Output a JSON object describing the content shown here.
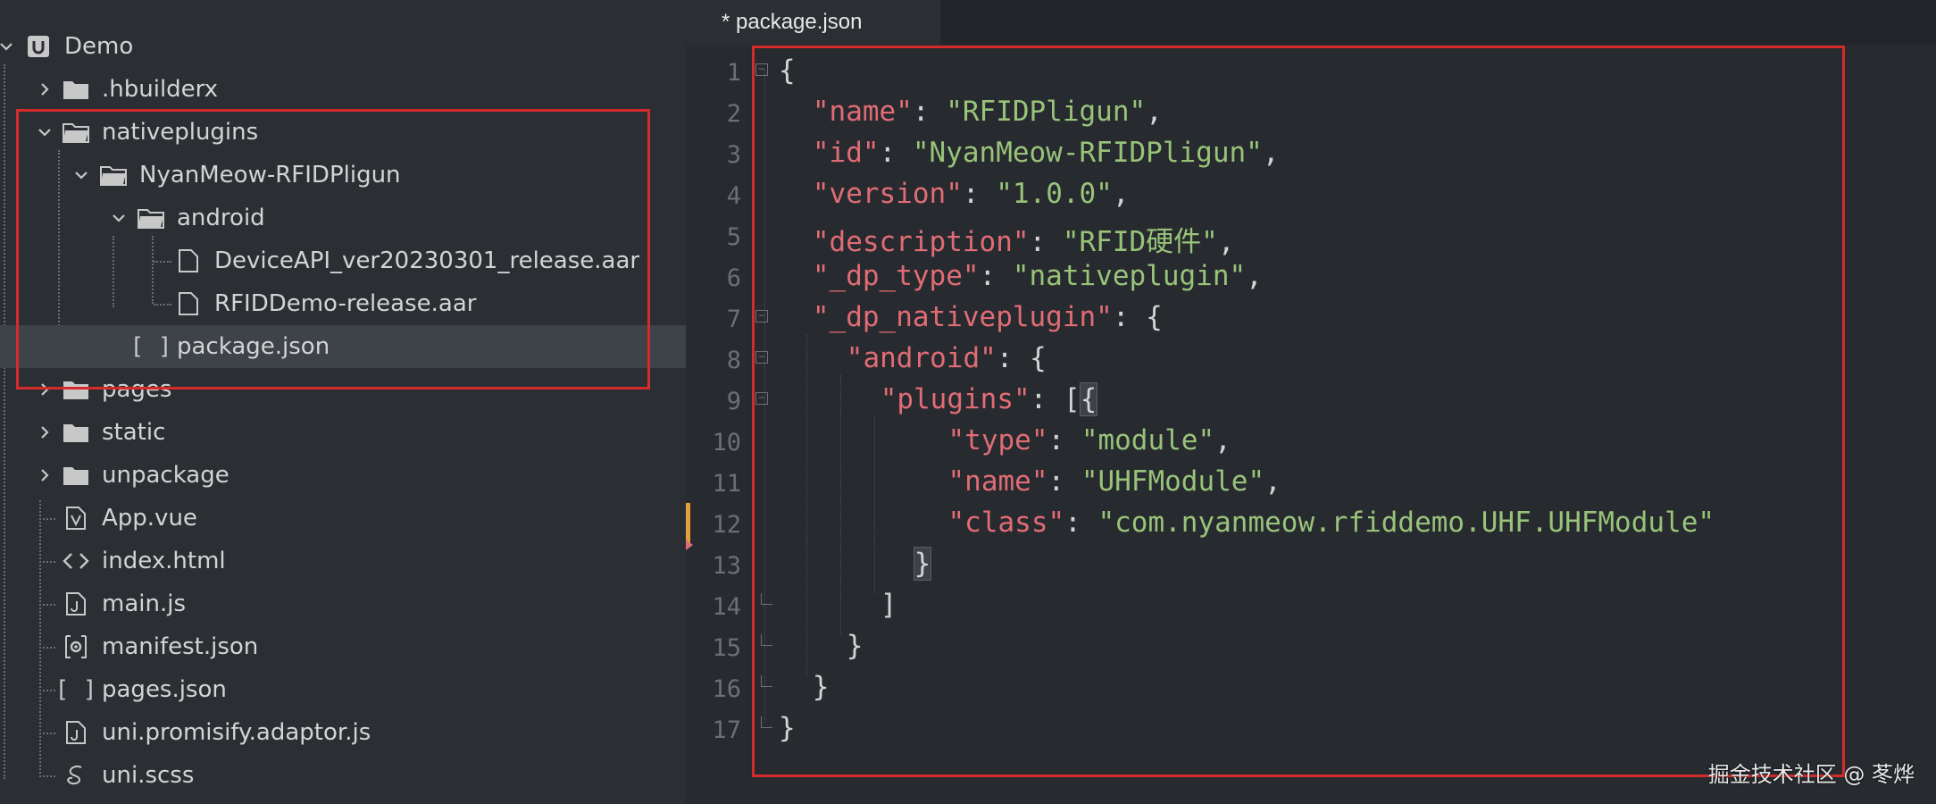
{
  "sidebar": {
    "root": {
      "label": "Demo",
      "icon": "project-icon"
    },
    "items": [
      {
        "label": ".hbuilderx",
        "type": "folder",
        "state": "collapsed"
      },
      {
        "label": "nativeplugins",
        "type": "folder",
        "state": "expanded"
      },
      {
        "label": "NyanMeow-RFIDPligun",
        "type": "folder",
        "state": "expanded"
      },
      {
        "label": "android",
        "type": "folder",
        "state": "expanded"
      },
      {
        "label": "DeviceAPI_ver20230301_release.aar",
        "type": "file"
      },
      {
        "label": "RFIDDemo-release.aar",
        "type": "file"
      },
      {
        "label": "package.json",
        "type": "json",
        "selected": true
      },
      {
        "label": "pages",
        "type": "folder",
        "state": "collapsed"
      },
      {
        "label": "static",
        "type": "folder",
        "state": "collapsed"
      },
      {
        "label": "unpackage",
        "type": "folder",
        "state": "collapsed"
      },
      {
        "label": "App.vue",
        "type": "vue"
      },
      {
        "label": "index.html",
        "type": "html"
      },
      {
        "label": "main.js",
        "type": "js"
      },
      {
        "label": "manifest.json",
        "type": "manifest"
      },
      {
        "label": "pages.json",
        "type": "json"
      },
      {
        "label": "uni.promisify.adaptor.js",
        "type": "js"
      },
      {
        "label": "uni.scss",
        "type": "scss"
      }
    ]
  },
  "editor": {
    "tab_label": "* package.json",
    "line_numbers": [
      "1",
      "2",
      "3",
      "4",
      "5",
      "6",
      "7",
      "8",
      "9",
      "10",
      "11",
      "12",
      "13",
      "14",
      "15",
      "16",
      "17"
    ],
    "lines": [
      {
        "open": "{"
      },
      {
        "key": "\"name\"",
        "colon": ": ",
        "value": "\"RFIDPligun\"",
        "tail": ","
      },
      {
        "key": "\"id\"",
        "colon": ": ",
        "value": "\"NyanMeow-RFIDPligun\"",
        "tail": ","
      },
      {
        "key": "\"version\"",
        "colon": ": ",
        "value": "\"1.0.0\"",
        "tail": ","
      },
      {
        "key": "\"description\"",
        "colon": ": ",
        "value": "\"RFID硬件\"",
        "tail": ","
      },
      {
        "key": "\"_dp_type\"",
        "colon": ": ",
        "value": "\"nativeplugin\"",
        "tail": ","
      },
      {
        "key": "\"_dp_nativeplugin\"",
        "colon": ": ",
        "tail": "{"
      },
      {
        "key": "\"android\"",
        "colon": ": ",
        "tail": "{"
      },
      {
        "key": "\"plugins\"",
        "colon": ": ",
        "tail": "[",
        "hl": "{"
      },
      {
        "key": "\"type\"",
        "colon": ": ",
        "value": "\"module\"",
        "tail": ","
      },
      {
        "key": "\"name\"",
        "colon": ": ",
        "value": "\"UHFModule\"",
        "tail": ","
      },
      {
        "key": "\"class\"",
        "colon": ": ",
        "value": "\"com.nyanmeow.rfiddemo.UHF.UHFModule\"",
        "tail": ""
      },
      {
        "hl": "}"
      },
      {
        "open": "]"
      },
      {
        "open": "}"
      },
      {
        "open": "}"
      },
      {
        "open": "}"
      }
    ]
  },
  "watermark": "掘金技术社区 @ 苳烨",
  "colors": {
    "key": "#e06c75",
    "string": "#98c379",
    "highlight_box": "#d52b2b",
    "modified_marker": "#e5a03b"
  }
}
